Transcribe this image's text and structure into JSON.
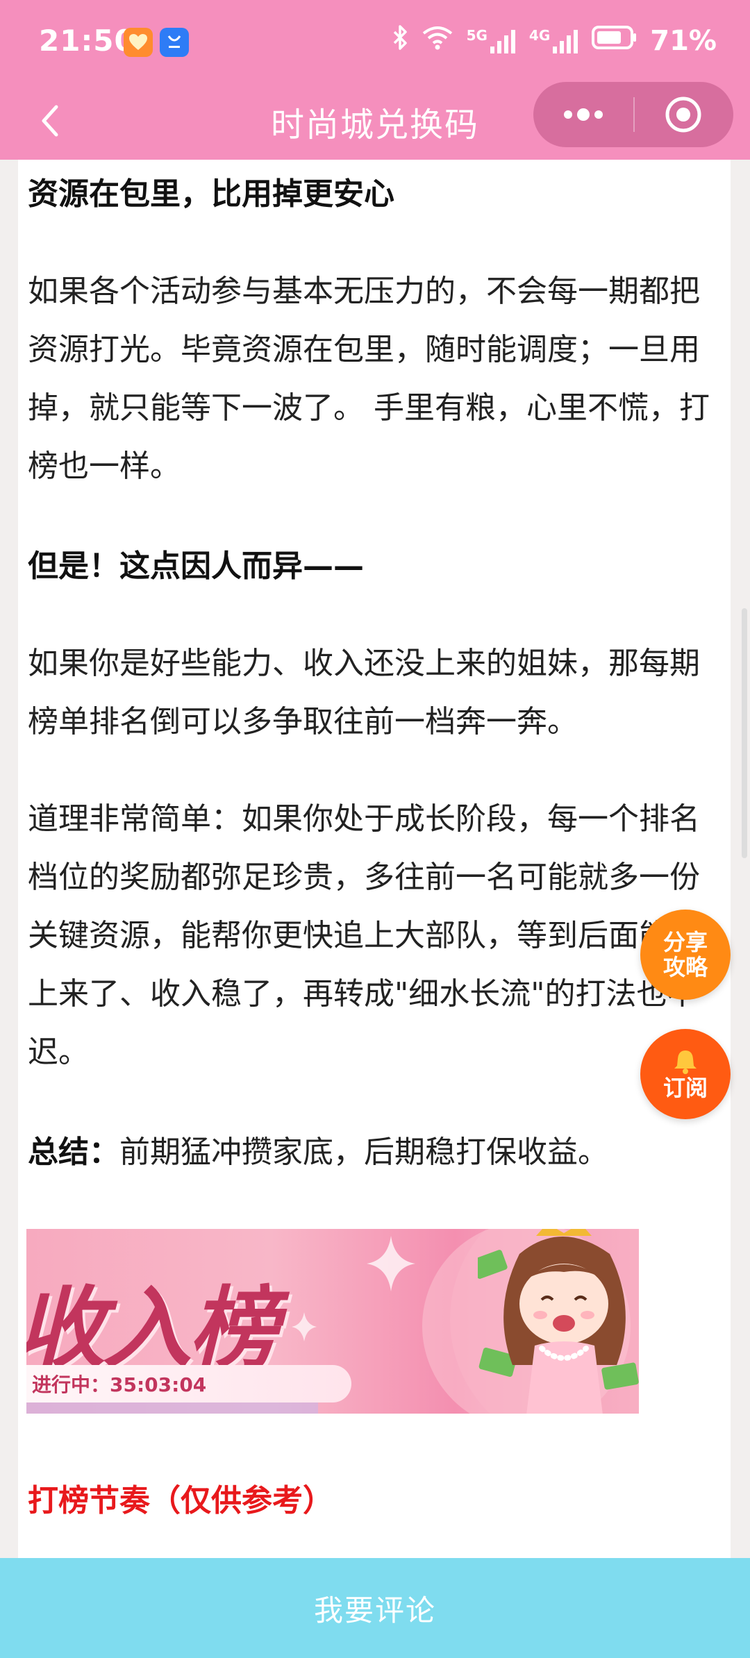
{
  "status_bar": {
    "time": "21:50",
    "network_5g": "5G",
    "network_4g": "4G",
    "battery": "71%"
  },
  "nav": {
    "title": "时尚城兑换码"
  },
  "article": {
    "heading_1": "资源在包里，比用掉更安心",
    "para_1": "如果各个活动参与基本无压力的，不会每一期都把资源打光。毕竟资源在包里，随时能调度；一旦用掉，就只能等下一波了。 手里有粮，心里不慌，打榜也一样。",
    "heading_2": "但是！这点因人而异——",
    "para_2": "如果你是好些能力、收入还没上来的姐妹，那每期榜单排名倒可以多争取往前一档奔一奔。",
    "para_3": "道理非常简单：如果你处于成长阶段，每一个排名档位的奖励都弥足珍贵，多往前一名可能就多一份关键资源，能帮你更快追上大部队，等到后面能力上来了、收入稳了，再转成\"细水长流\"的打法也不迟。",
    "summary_label": "总结：",
    "summary_text": "前期猛冲攒家底，后期稳打保收益。",
    "red_heading": "打榜节奏（仅供参考）"
  },
  "banner": {
    "title": "收入榜",
    "timer": "进行中：35:03:04"
  },
  "floating": {
    "share_line1": "分享",
    "share_line2": "攻略",
    "subscribe": "订阅"
  },
  "footer": {
    "comment_label": "我要评论"
  },
  "colors": {
    "header_pink": "#f58fbd",
    "comment_bar": "#7fdcef",
    "share_orange": "#ff8a14",
    "subscribe_orange": "#ff5b12",
    "heading_red": "#e8191c"
  }
}
